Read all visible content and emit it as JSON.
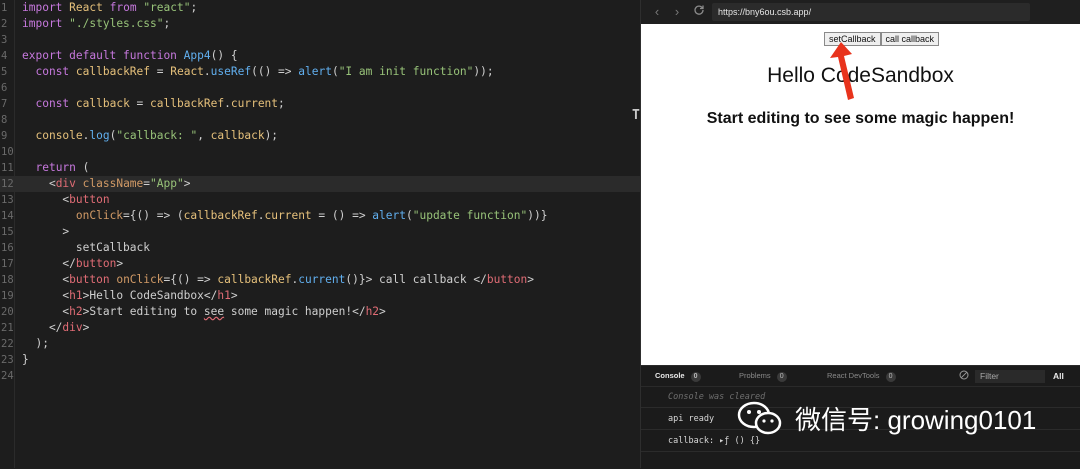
{
  "editor": {
    "lines": [
      {
        "n": "1",
        "html": "<span class=\"k\">import</span> <span class=\"v\">React</span> <span class=\"k\">from</span> <span class=\"s\">\"react\"</span>;"
      },
      {
        "n": "2",
        "html": "<span class=\"k\">import</span> <span class=\"s\">\"./styles.css\"</span>;"
      },
      {
        "n": "3",
        "html": ""
      },
      {
        "n": "4",
        "html": "<span class=\"k\">export default function</span> <span class=\"fn\">App4</span>() {"
      },
      {
        "n": "5",
        "html": "  <span class=\"k\">const</span> <span class=\"v\">callbackRef</span> = <span class=\"v\">React</span>.<span class=\"fn\">useRef</span>(() => <span class=\"fn\">alert</span>(<span class=\"s\">\"I am init function\"</span>));"
      },
      {
        "n": "6",
        "html": ""
      },
      {
        "n": "7",
        "html": "  <span class=\"k\">const</span> <span class=\"v\">callback</span> = <span class=\"v\">callbackRef</span>.<span class=\"v\">current</span>;"
      },
      {
        "n": "8",
        "html": ""
      },
      {
        "n": "9",
        "html": "  <span class=\"v\">console</span>.<span class=\"fn\">log</span>(<span class=\"s\">\"callback: \"</span>, <span class=\"v\">callback</span>);"
      },
      {
        "n": "10",
        "html": ""
      },
      {
        "n": "11",
        "html": "  <span class=\"k\">return</span> ("
      },
      {
        "n": "12",
        "html": "    &lt;<span class=\"tag\">div</span> <span class=\"attr\">className</span>=<span class=\"s\">\"App\"</span>&gt;"
      },
      {
        "n": "13",
        "html": "      &lt;<span class=\"tag\">button</span>"
      },
      {
        "n": "14",
        "html": "        <span class=\"attr\">onClick</span>={() => (<span class=\"v\">callbackRef</span>.<span class=\"v\">current</span> = () => <span class=\"fn\">alert</span>(<span class=\"s\">\"update function\"</span>))}"
      },
      {
        "n": "15",
        "html": "      &gt;"
      },
      {
        "n": "16",
        "html": "        setCallback"
      },
      {
        "n": "17",
        "html": "      &lt;/<span class=\"tag\">button</span>&gt;"
      },
      {
        "n": "18",
        "html": "      &lt;<span class=\"tag\">button</span> <span class=\"attr\">onClick</span>={() => <span class=\"v\">callbackRef</span>.<span class=\"fn\">current</span>()}&gt; call callback &lt;/<span class=\"tag\">button</span>&gt;"
      },
      {
        "n": "19",
        "html": "      &lt;<span class=\"tag\">h1</span>&gt;Hello CodeSandbox&lt;/<span class=\"tag\">h1</span>&gt;"
      },
      {
        "n": "20",
        "html": "      &lt;<span class=\"tag\">h2</span>&gt;Start editing to <span class=\"sq\">see</span> some magic happen!&lt;/<span class=\"tag\">h2</span>&gt;"
      },
      {
        "n": "21",
        "html": "    &lt;/<span class=\"tag\">div</span>&gt;"
      },
      {
        "n": "22",
        "html": "  );"
      },
      {
        "n": "23",
        "html": "}"
      },
      {
        "n": "24",
        "html": ""
      }
    ],
    "active_line_index": 11,
    "splitter_mark": "T"
  },
  "browser": {
    "back_icon": "chevron-left-icon",
    "forward_icon": "chevron-right-icon",
    "refresh_icon": "refresh-icon",
    "url": "https://bny6ou.csb.app/",
    "buttons": [
      "setCallback",
      "call callback"
    ],
    "h1": "Hello CodeSandbox",
    "h2": "Start editing to see some magic happen!",
    "arrow_color": "#e8331c"
  },
  "console": {
    "tabs": [
      {
        "label": "Console",
        "count": "0"
      },
      {
        "label": "Problems",
        "count": "0"
      },
      {
        "label": "React DevTools",
        "count": "0"
      }
    ],
    "filter_placeholder": "Filter",
    "all_label": "All",
    "cleared": "Console was cleared",
    "lines": [
      "api ready",
      "callback:  ▸ƒ () {}"
    ]
  },
  "watermark": {
    "text": "微信号: growing0101"
  }
}
